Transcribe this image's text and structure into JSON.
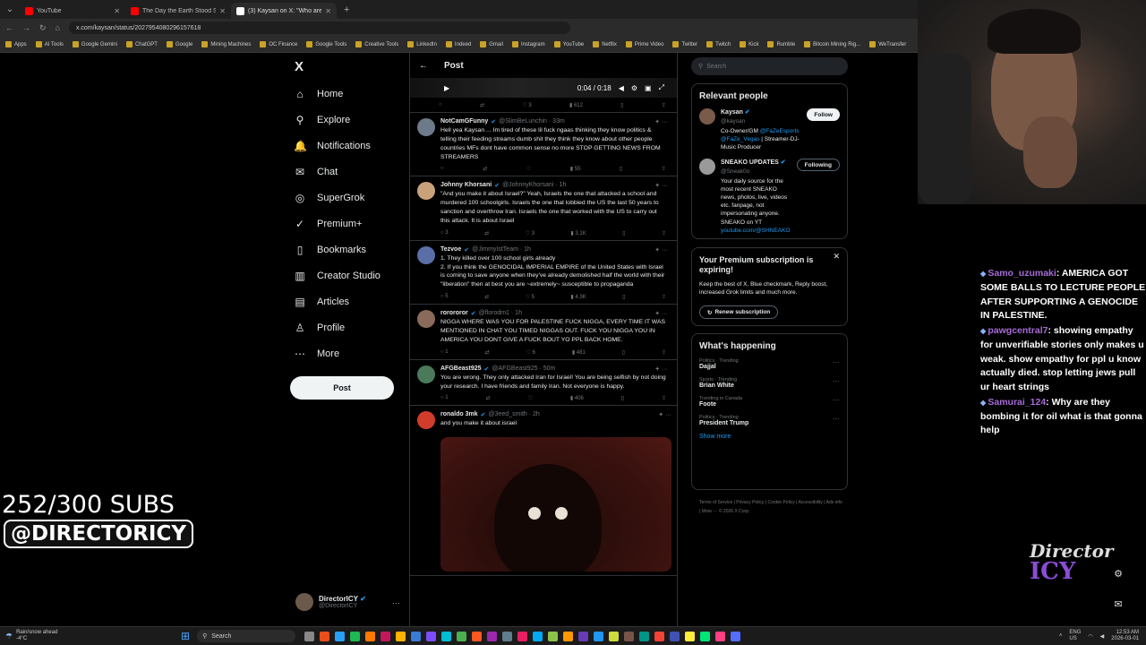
{
  "browser": {
    "tabs": [
      {
        "title": "YouTube",
        "color": "#ff0000",
        "active": false
      },
      {
        "title": "The Day the Earth Stood Still (2...",
        "color": "#ff0000",
        "active": false
      },
      {
        "title": "(3) Kaysan on X: \"Who are you t...",
        "color": "#ffffff",
        "active": true
      }
    ],
    "url": "x.com/kaysan/status/2027954080296157618",
    "bookmarks": [
      "Apps",
      "AI Tools",
      "Google Gemini",
      "ChatGPT",
      "Google",
      "Mining Machines",
      "OC Finance",
      "Google Tools",
      "Creative Tools",
      "LinkedIn",
      "Indeed",
      "Gmail",
      "Instagram",
      "YouTube",
      "Netflix",
      "Prime Video",
      "Twitter",
      "Twitch",
      "Kick",
      "Rumble",
      "Bitcoin Mining Rig...",
      "WeTransfer"
    ]
  },
  "nav": {
    "logo": "X",
    "items": [
      {
        "label": "Home",
        "icon": "⌂"
      },
      {
        "label": "Explore",
        "icon": "⚲"
      },
      {
        "label": "Notifications",
        "icon": "🔔"
      },
      {
        "label": "Chat",
        "icon": "✉"
      },
      {
        "label": "SuperGrok",
        "icon": "◎"
      },
      {
        "label": "Premium+",
        "icon": "✓"
      },
      {
        "label": "Bookmarks",
        "icon": "▯"
      },
      {
        "label": "Creator Studio",
        "icon": "▥"
      },
      {
        "label": "Articles",
        "icon": "▤"
      },
      {
        "label": "Profile",
        "icon": "♙"
      },
      {
        "label": "More",
        "icon": "⋯"
      }
    ],
    "post_label": "Post",
    "account": {
      "name": "DirectorICY",
      "handle": "@DirectorICY"
    }
  },
  "column": {
    "title": "Post",
    "player_time": "0:04 / 0:18",
    "top_actions": {
      "likes": "3",
      "views": "612"
    },
    "tweets": [
      {
        "name": "NotCamGFunny",
        "handle": "@SlimBeLunchin · 33m",
        "avatar": "#6c7a89",
        "text": "Hell yea Kaysan ... Im tired of these lil fuck ngaas thinking they know politics & telling their feeding streams dumb shit they think they know about other people countries MFs dont have common sense no more STOP GETTING NEWS FROM STREAMERS",
        "replies": "",
        "reposts": "",
        "likes": "",
        "views": "55"
      },
      {
        "name": "Johnny Khorsani",
        "handle": "@JohnnyKhorsani · 1h",
        "avatar": "#c8a27a",
        "text": "\"And you make it about Israel?\" Yeah, Israels the one that attacked a school and murdered 100 schoolgirls. Israels the one that lobbied the US the last 50 years to sanction and overthrow Iran. Israels the one that worked with the US to carry out this attack. It is about Israel",
        "replies": "3",
        "reposts": "",
        "likes": "3",
        "views": "3.1K"
      },
      {
        "name": "Tezvoe",
        "handle": "@JimmyIstTeam · 1h",
        "avatar": "#5a6fa8",
        "text": "1. They killed over 100 school girls already\n2. If you think the GENOCIDAL IMPERIAL EMPIRE of the United States with Israel is coming to save anyone when they've already demolished half the world with their \"liberation\" then at best you are ~extremely~ susceptible to propaganda",
        "replies": "5",
        "reposts": "",
        "likes": "5",
        "views": "4.3K"
      },
      {
        "name": "rorororor",
        "handle": "@florodm1 · 1h",
        "avatar": "#8a6a5a",
        "text": "NIGGA WHERE WAS YOU FOR PALESTINE FUCK NIGGA, EVERY TIME IT WAS MENTIONED IN CHAT YOU TIMED NIGGAS OUT. FUCK YOU NIGGA YOU IN AMERICA YOU DONT GIVE A FUCK BOUT YO PPL BACK HOME.",
        "replies": "1",
        "reposts": "",
        "likes": "6",
        "views": "481"
      },
      {
        "name": "AFGBeast925",
        "handle": "@AFGBeast925 · 50m",
        "avatar": "#4a7a5a",
        "text": "You are wrong. They only attacked Iran for Israel! You are being selfish by not doing your research.  I have friends and family Iran. Not everyone is happy.",
        "replies": "1",
        "reposts": "",
        "likes": "",
        "views": "406"
      },
      {
        "name": "ronaldo 3mk",
        "handle": "@3eed_smith · 2h",
        "avatar": "#d23c2a",
        "text": "and you make it about israel",
        "replies": "",
        "reposts": "",
        "likes": "",
        "views": "",
        "media": true
      }
    ]
  },
  "sidebar": {
    "search_placeholder": "Search",
    "relevant_title": "Relevant people",
    "people": [
      {
        "name": "Kaysan",
        "handle": "@kaysan",
        "bio_a": "Co-Owner/GM ",
        "bio_link1": "@FaZeEsports",
        "bio_b": " ",
        "bio_link2": "@FaZe_Vegas",
        "bio_c": " | Streamer-DJ-Music Producer",
        "button": "Follow",
        "avatar": "#7a5a48"
      },
      {
        "name": "SNEAKO UPDATES",
        "handle": "@Sneak0o",
        "bio_a": "Your daily source for the most recent SNEAKO news, photos, live, videos etc. fanpage, not impersonating anyone. SNEAKO on YT ",
        "bio_link1": "youtube.com/@SHNEAKO",
        "bio_b": "",
        "bio_link2": "",
        "bio_c": "",
        "button": "Following",
        "avatar": "#9a9a9a"
      }
    ],
    "premium": {
      "title": "Your Premium subscription is expiring!",
      "desc": "Keep the best of X. Blue checkmark, Reply boost, increased Grok limits and much more.",
      "button": "Renew subscription"
    },
    "happening_title": "What's happening",
    "trends": [
      {
        "category": "Politics · Trending",
        "name": "Dajjal"
      },
      {
        "category": "Sports · Trending",
        "name": "Brian White"
      },
      {
        "category": "Trending in Canada",
        "name": "Foote"
      },
      {
        "category": "Politics · Trending",
        "name": "President Trump"
      }
    ],
    "show_more": "Show more",
    "footer": "Terms of Service  |  Privacy Policy  |  Cookie Policy  |  Accessibility  |  Ads info  |  More ···  © 2026 X Corp."
  },
  "overlay": {
    "chat": [
      {
        "user": "Samo_uzumaki",
        "text": ": AMERICA GOT SOME BALLS TO LECTURE PEOPLE AFTER SUPPORTING A GENOCIDE IN PALESTINE."
      },
      {
        "user": "pawgcentral7",
        "text": ": showing empathy for unverifiable stories only makes u weak. show empathy for ppl u know actually died. stop letting jews pull ur heart strings"
      },
      {
        "user": "Samurai_124",
        "text": ": Why are they bombing it for oil what is that gonna help"
      }
    ],
    "subs": "252/300 SUBS",
    "handle": "@DIRECTORICY",
    "brand_top": "Director",
    "brand_bottom": "ICY"
  },
  "taskbar": {
    "weather_line1": "Rain/snow ahead",
    "weather_line2": "-4°C",
    "search": "Search",
    "lang": "ENG\nUS",
    "time": "12:53 AM",
    "date": "2026-03-01",
    "app_colors": [
      "#888",
      "#e94e1b",
      "#2aa1f5",
      "#1db954",
      "#ff7a00",
      "#c2185b",
      "#ffb300",
      "#3a7bd5",
      "#7c4dff",
      "#00bcd4",
      "#4caf50",
      "#ff5722",
      "#9c27b0",
      "#607d8b",
      "#e91e63",
      "#03a9f4",
      "#8bc34a",
      "#ff9800",
      "#673ab7",
      "#2196f3",
      "#cddc39",
      "#795548",
      "#009688",
      "#f44336",
      "#3f51b5",
      "#ffeb3b",
      "#00e676",
      "#ff4081",
      "#536dfe"
    ]
  }
}
